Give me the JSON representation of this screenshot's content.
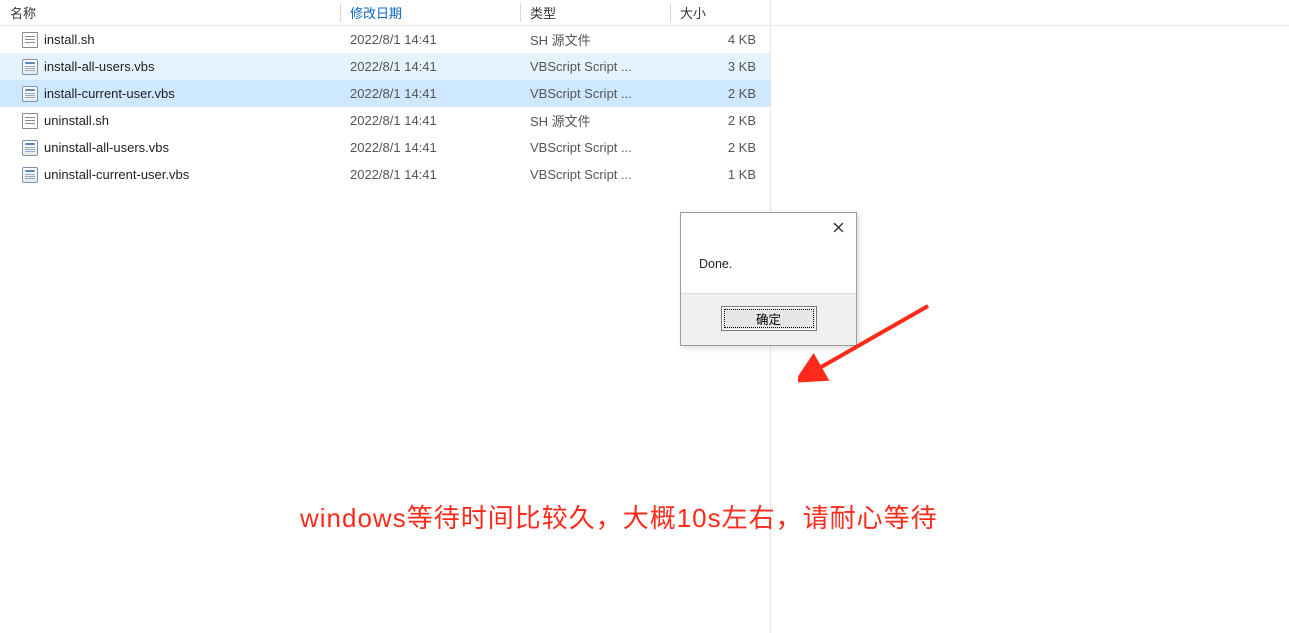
{
  "columns": {
    "name": "名称",
    "date": "修改日期",
    "type": "类型",
    "size": "大小"
  },
  "files": [
    {
      "icon": "sh",
      "name": "install.sh",
      "date": "2022/8/1 14:41",
      "type": "SH 源文件",
      "size": "4 KB",
      "state": ""
    },
    {
      "icon": "vbs",
      "name": "install-all-users.vbs",
      "date": "2022/8/1 14:41",
      "type": "VBScript Script ...",
      "size": "3 KB",
      "state": "hover"
    },
    {
      "icon": "vbs",
      "name": "install-current-user.vbs",
      "date": "2022/8/1 14:41",
      "type": "VBScript Script ...",
      "size": "2 KB",
      "state": "selected"
    },
    {
      "icon": "sh",
      "name": "uninstall.sh",
      "date": "2022/8/1 14:41",
      "type": "SH 源文件",
      "size": "2 KB",
      "state": ""
    },
    {
      "icon": "vbs",
      "name": "uninstall-all-users.vbs",
      "date": "2022/8/1 14:41",
      "type": "VBScript Script ...",
      "size": "2 KB",
      "state": ""
    },
    {
      "icon": "vbs",
      "name": "uninstall-current-user.vbs",
      "date": "2022/8/1 14:41",
      "type": "VBScript Script ...",
      "size": "1 KB",
      "state": ""
    }
  ],
  "dialog": {
    "message": "Done.",
    "ok_label": "确定"
  },
  "annotation": {
    "caption": "windows等待时间比较久，大概10s左右，请耐心等待",
    "arrow_color": "#ff2a1a"
  }
}
